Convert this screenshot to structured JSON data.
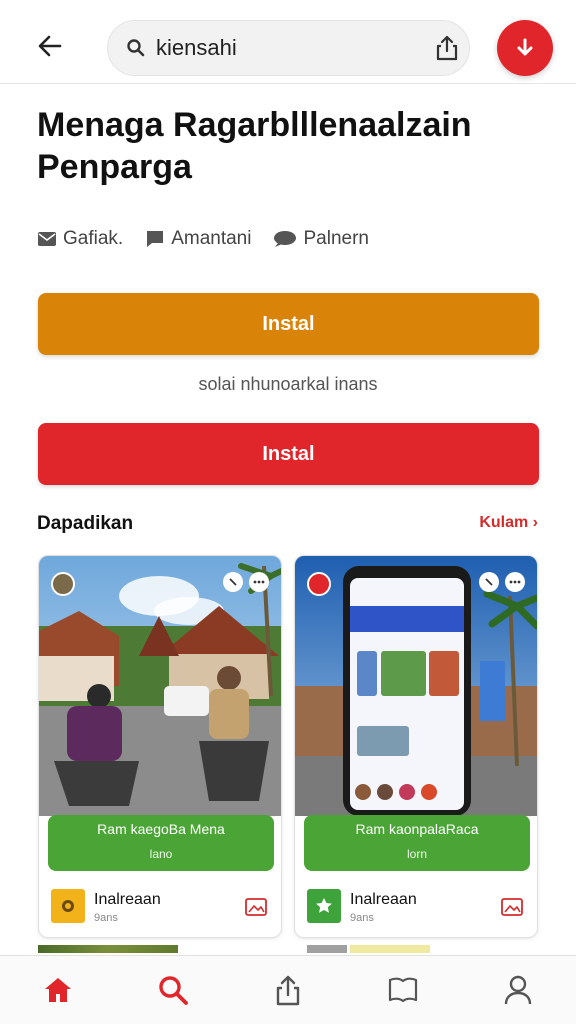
{
  "header": {
    "search_text": "kiensahi",
    "icons": [
      "back-arrow-icon",
      "search-icon",
      "share-icon",
      "download-icon"
    ]
  },
  "title": {
    "line1": "Menaga Ragarblllenaalzain",
    "line2": "Penparga"
  },
  "meta": [
    {
      "icon": "mail-icon",
      "label": "Gafiak."
    },
    {
      "icon": "chat-icon",
      "label": "Amantani"
    },
    {
      "icon": "message-icon",
      "label": "Palnern"
    }
  ],
  "buttons": {
    "install_primary": "Instal",
    "subnote": "solai nhunoarkal inans",
    "install_secondary": "Instal"
  },
  "section": {
    "title": "Dapadikan",
    "link": "Kulam ›"
  },
  "cards": [
    {
      "overlay_title": "Ram kaegoBa Mena",
      "overlay_sub": "lano",
      "app_name": "Inalreaan",
      "app_sub": "9ans"
    },
    {
      "overlay_title": "Ram kaonpalaRaca",
      "overlay_sub": "lorn",
      "app_name": "Inalreaan",
      "app_sub": "9ans"
    }
  ],
  "tabs": [
    "home-icon",
    "search-icon",
    "share-icon",
    "book-icon",
    "profile-icon"
  ],
  "colors": {
    "accent_red": "#e0262b",
    "install_orange": "#d98408",
    "overlay_green": "#4ba536",
    "link_red": "#d52b2b"
  }
}
